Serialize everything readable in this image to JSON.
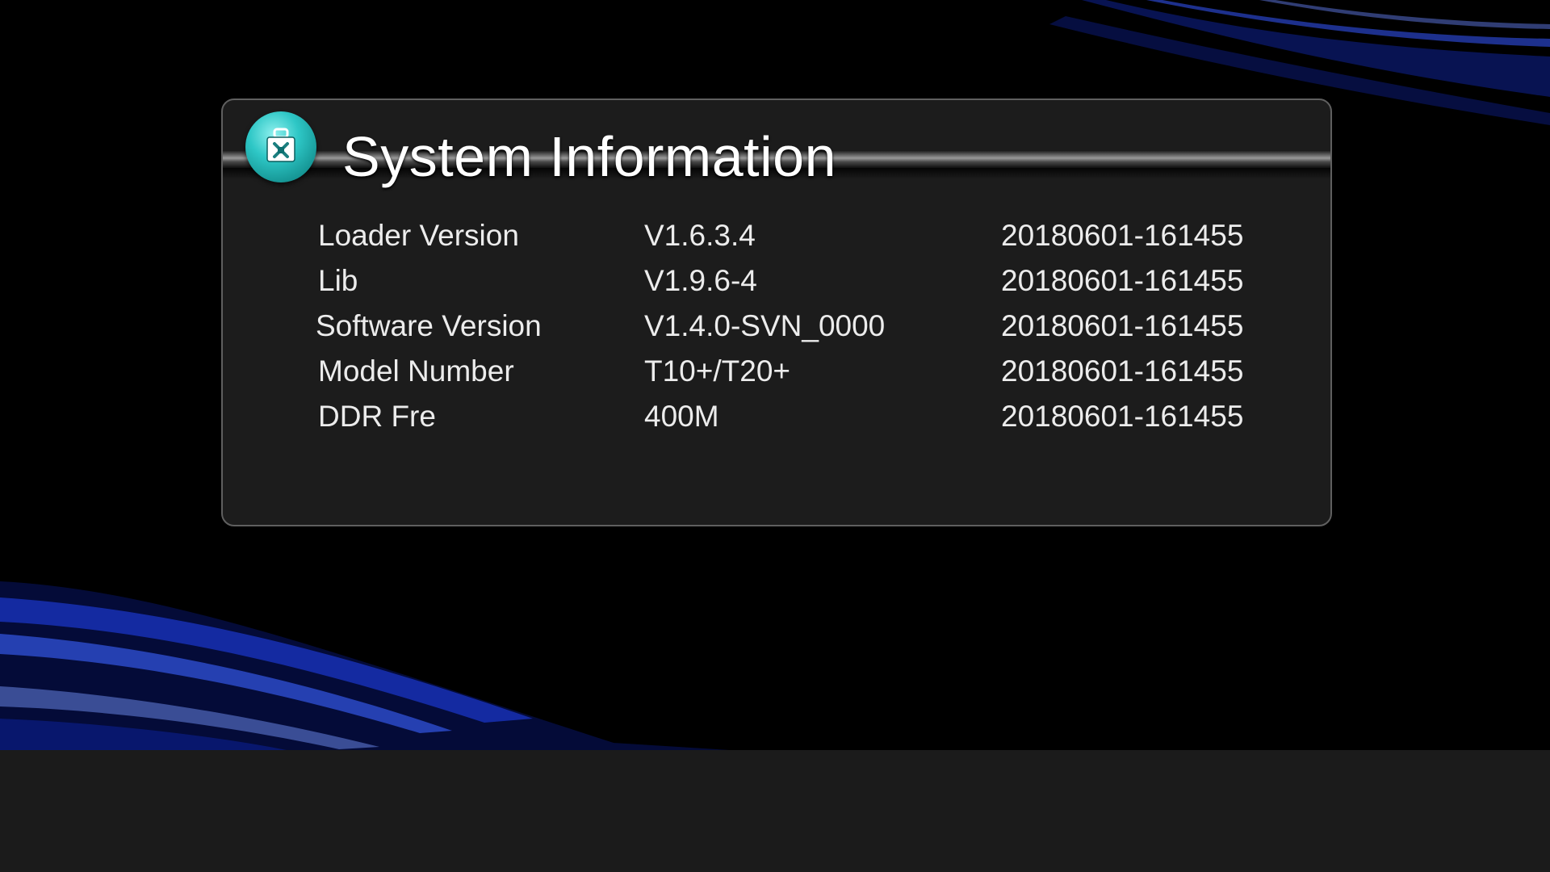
{
  "window": {
    "title": "System Information",
    "icon": "toolbox-icon"
  },
  "rows": [
    {
      "label": "Loader Version",
      "value": "V1.6.3.4",
      "date": "20180601-161455"
    },
    {
      "label": "Lib",
      "value": "V1.9.6-4",
      "date": "20180601-161455"
    },
    {
      "label": "Software Version",
      "value": "V1.4.0-SVN_0000",
      "date": "20180601-161455"
    },
    {
      "label": "Model Number",
      "value": "T10+/T20+",
      "date": "20180601-161455"
    },
    {
      "label": "DDR Fre",
      "value": "400M",
      "date": "20180601-161455"
    }
  ],
  "colors": {
    "background": "#000000",
    "panel": "#1c1c1c",
    "accent_icon": "#2ec7c6",
    "text": "#ececec",
    "bottom_bar": "#1b1b1b"
  }
}
